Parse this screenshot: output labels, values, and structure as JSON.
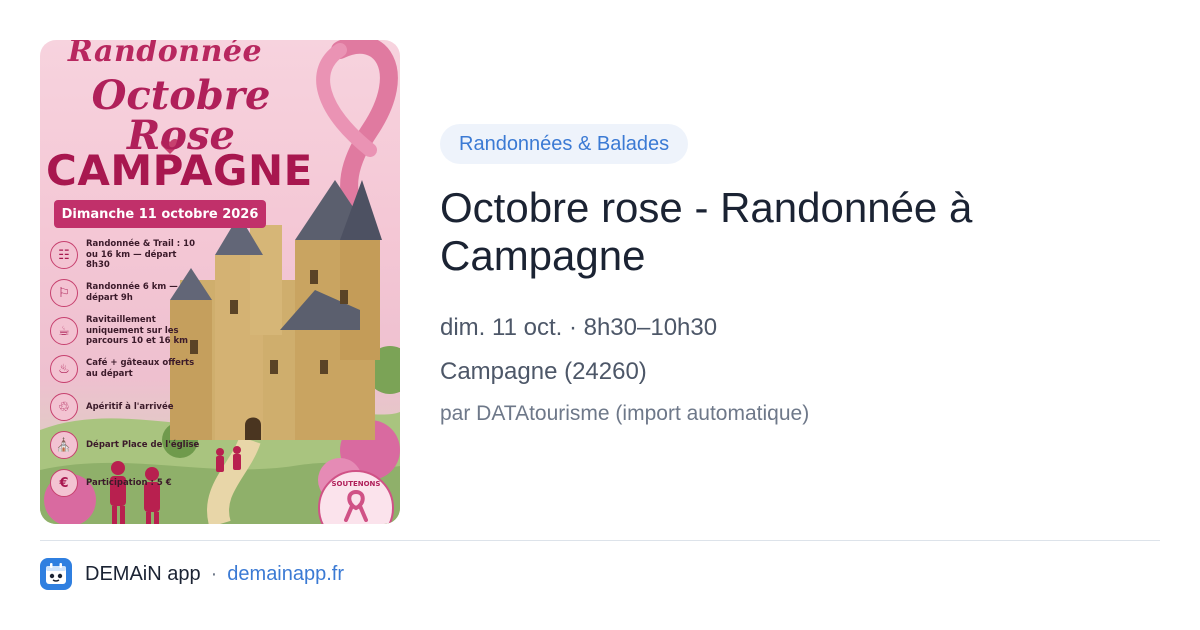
{
  "poster": {
    "top_title": "Randonnée",
    "title": "Octobre Rose",
    "town": "CAMPAGNE",
    "date": "Dimanche 11 octobre 2026",
    "items": [
      {
        "icon": "hikers-icon",
        "glyph": "☷",
        "text": "Randonnée & Trail : 10 ou 16 km — départ 8h30"
      },
      {
        "icon": "walker-icon",
        "glyph": "⚐",
        "text": "Randonnée 6 km — départ 9h"
      },
      {
        "icon": "supply-icon",
        "glyph": "☕",
        "text": "Ravitaillement uniquement sur les parcours 10 et 16 km"
      },
      {
        "icon": "cake-icon",
        "glyph": "♨",
        "text": "Café + gâteaux offerts au départ"
      },
      {
        "icon": "glasses-icon",
        "glyph": "♲",
        "text": "Apéritif à l'arrivée"
      },
      {
        "icon": "church-icon",
        "glyph": "⛪",
        "text": "Départ Place de l'église"
      },
      {
        "icon": "euro-icon",
        "glyph": "€",
        "text": "Participation : 5 €"
      }
    ],
    "badge": "SOUTENONS"
  },
  "event": {
    "category": "Randonnées & Balades",
    "title": "Octobre rose - Randonnée à Campagne",
    "datetime": "dim. 11 oct. · 8h30–10h30",
    "place": "Campagne (24260)",
    "author": "par DATAtourisme (import automatique)"
  },
  "footer": {
    "app_name": "DEMAiN app",
    "separator": "·",
    "link": "demainapp.fr"
  },
  "colors": {
    "accent": "#3b7ad4",
    "tag_bg": "#eef3fb",
    "poster_pink": "#b0205a"
  }
}
